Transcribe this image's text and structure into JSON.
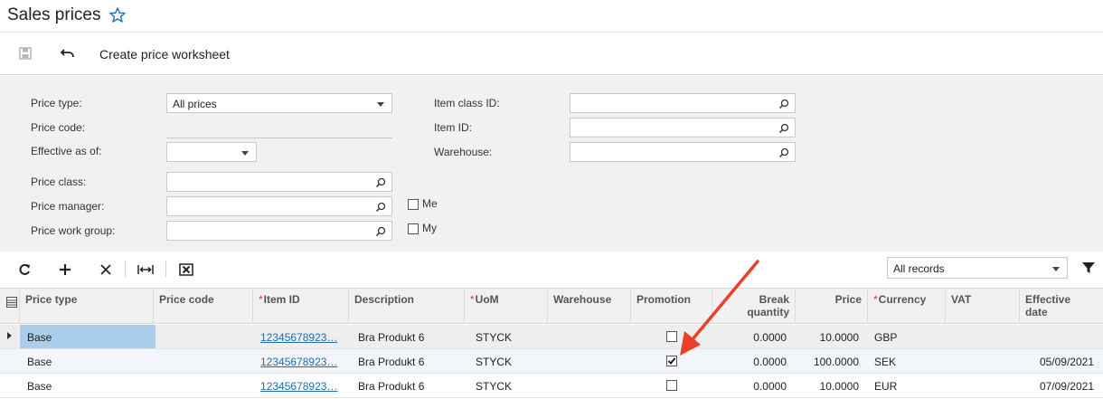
{
  "header": {
    "title": "Sales prices",
    "favorite_icon": "star-outline-icon"
  },
  "toolbar": {
    "save_icon": "save-icon",
    "undo_icon": "undo-icon",
    "create_label": "Create price worksheet"
  },
  "filters": {
    "price_type": {
      "label": "Price type:",
      "value": "All prices"
    },
    "price_code": {
      "label": "Price code:",
      "value": ""
    },
    "effective_as_of": {
      "label": "Effective as of:",
      "value": ""
    },
    "price_class": {
      "label": "Price class:",
      "value": ""
    },
    "price_manager": {
      "label": "Price manager:",
      "value": "",
      "me_label": "Me",
      "me_checked": false
    },
    "price_work_group": {
      "label": "Price work group:",
      "value": "",
      "my_label": "My",
      "my_checked": false
    },
    "item_class_id": {
      "label": "Item class ID:",
      "value": ""
    },
    "item_id": {
      "label": "Item ID:",
      "value": ""
    },
    "warehouse": {
      "label": "Warehouse:",
      "value": ""
    }
  },
  "grid_toolbar": {
    "records_filter": "All records"
  },
  "grid": {
    "columns": [
      {
        "label": "Price type",
        "required": false
      },
      {
        "label": "Price code",
        "required": false
      },
      {
        "label": "Item ID",
        "required": true
      },
      {
        "label": "Description",
        "required": false
      },
      {
        "label": "UoM",
        "required": true
      },
      {
        "label": "Warehouse",
        "required": false
      },
      {
        "label": "Promotion",
        "required": false
      },
      {
        "label": "Break",
        "label2": "quantity",
        "required": false
      },
      {
        "label": "Price",
        "required": false
      },
      {
        "label": "Currency",
        "required": true
      },
      {
        "label": "VAT",
        "required": false
      },
      {
        "label": "Effective",
        "label2": "date",
        "required": false
      }
    ],
    "rows": [
      {
        "price_type": "Base",
        "price_code": "",
        "item_id": "12345678923…",
        "description": "Bra Produkt 6",
        "uom": "STYCK",
        "warehouse": "",
        "promotion": false,
        "break_qty": "0.0000",
        "price": "10.0000",
        "currency": "GBP",
        "vat": "",
        "effective_date": ""
      },
      {
        "price_type": "Base",
        "price_code": "",
        "item_id": "12345678923…",
        "description": "Bra Produkt 6",
        "uom": "STYCK",
        "warehouse": "",
        "promotion": true,
        "break_qty": "0.0000",
        "price": "100.0000",
        "currency": "SEK",
        "vat": "",
        "effective_date": "05/09/2021"
      },
      {
        "price_type": "Base",
        "price_code": "",
        "item_id": "12345678923…",
        "description": "Bra Produkt 6",
        "uom": "STYCK",
        "warehouse": "",
        "promotion": false,
        "break_qty": "0.0000",
        "price": "10.0000",
        "currency": "EUR",
        "vat": "",
        "effective_date": "07/09/2021"
      }
    ]
  },
  "colors": {
    "accent": "#1a6fb3",
    "required": "#d9363e",
    "selected_cell": "#a9cdea",
    "annotation_arrow": "#e8402a"
  }
}
